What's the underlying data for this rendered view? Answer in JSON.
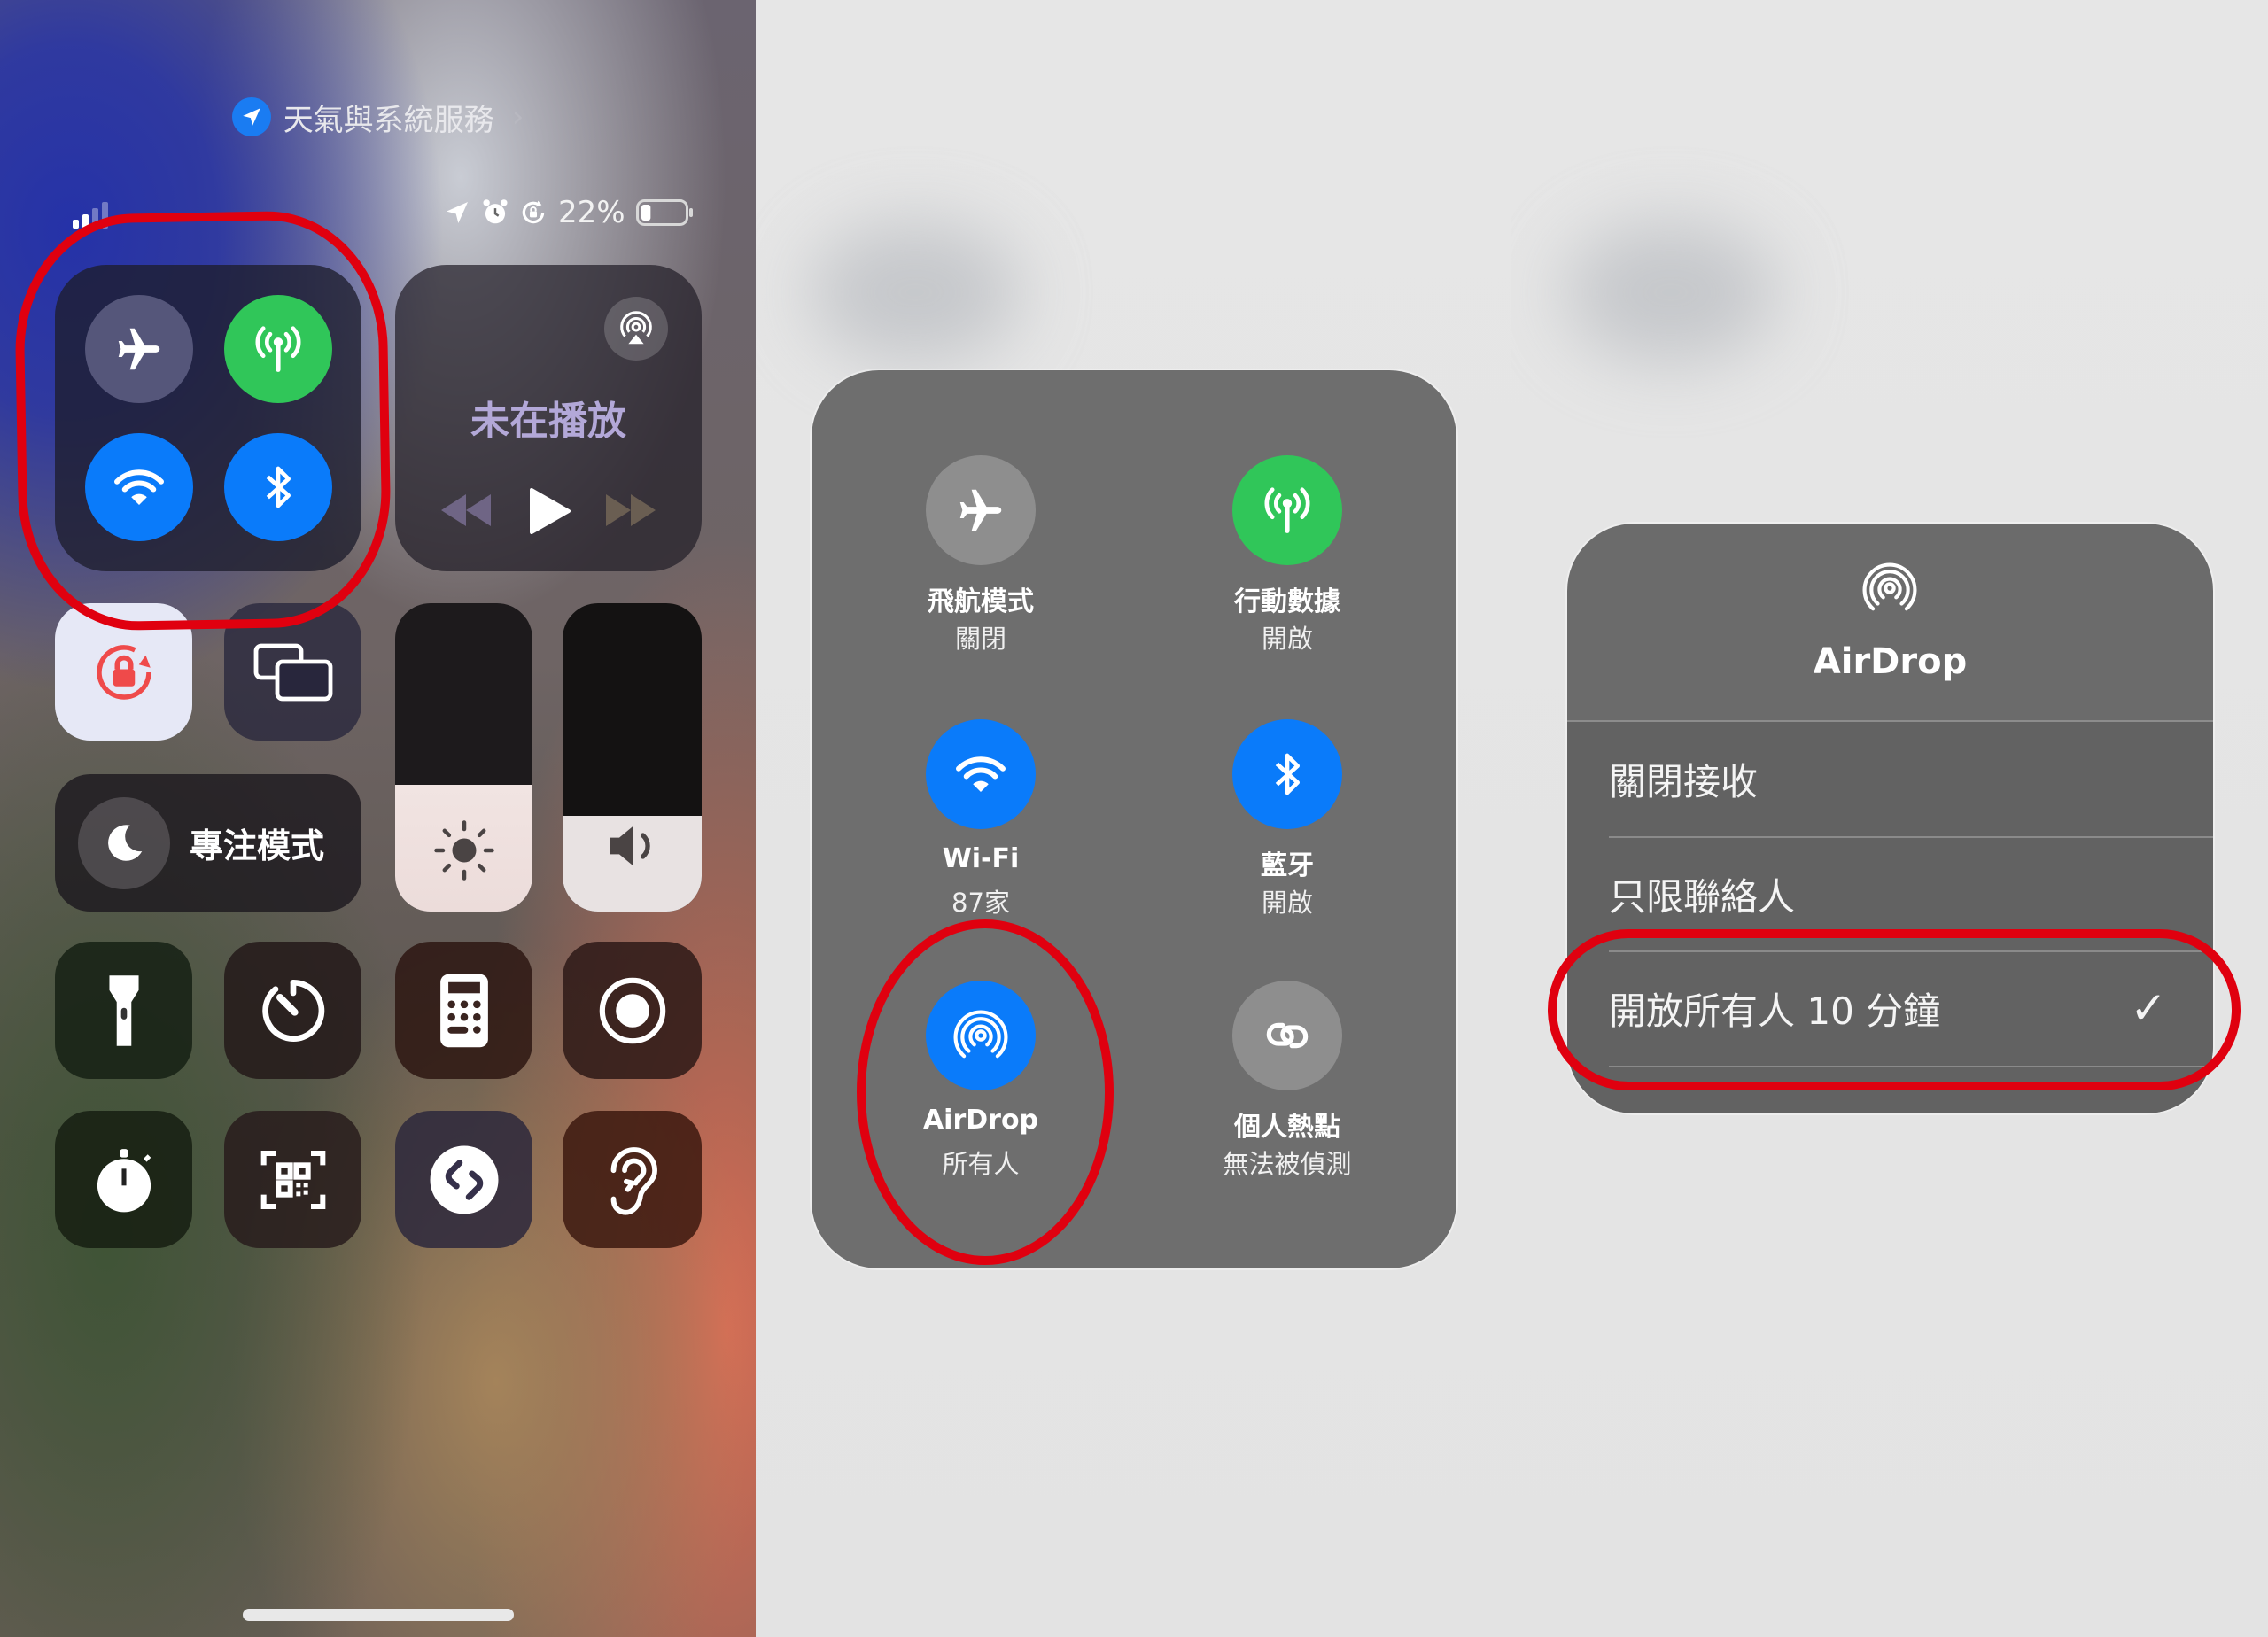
{
  "panel1": {
    "header": {
      "location_icon": "location-arrow-icon",
      "text": "天氣與系統服務",
      "chevron": "›"
    },
    "status_bar": {
      "signal_icon": "cellular-signal-icon",
      "icons": [
        "location-arrow-icon",
        "alarm-icon",
        "orientation-lock-icon"
      ],
      "battery_percent": "22%",
      "battery_level": 0.22
    },
    "connectivity": [
      {
        "id": "airplane",
        "icon": "airplane-icon",
        "state": "off",
        "color": "#55567a"
      },
      {
        "id": "cellular",
        "icon": "antenna-icon",
        "state": "on",
        "color": "#30c659"
      },
      {
        "id": "wifi",
        "icon": "wifi-icon",
        "state": "on",
        "color": "#0a7bfa"
      },
      {
        "id": "bluetooth",
        "icon": "bluetooth-icon",
        "state": "on",
        "color": "#0a7bfa"
      }
    ],
    "media": {
      "airplay_icon": "airplay-icon",
      "title": "未在播放",
      "controls": [
        "rewind-icon",
        "play-icon",
        "fast-forward-icon"
      ]
    },
    "rotation_lock": {
      "icon": "rotation-lock-icon",
      "active": true,
      "color": "#ef4a4a"
    },
    "screen_mirroring": {
      "icon": "screen-mirroring-icon"
    },
    "focus": {
      "icon": "moon-icon",
      "label": "專注模式"
    },
    "brightness": {
      "icon": "sun-icon",
      "level": 0.41
    },
    "volume": {
      "icon": "speaker-icon",
      "level": 0.31
    },
    "shortcuts": [
      {
        "icon": "flashlight-icon"
      },
      {
        "icon": "timer-icon"
      },
      {
        "icon": "calculator-icon"
      },
      {
        "icon": "screen-record-icon"
      },
      {
        "icon": "stopwatch-icon"
      },
      {
        "icon": "qr-scanner-icon"
      },
      {
        "icon": "shazam-icon"
      },
      {
        "icon": "hearing-icon"
      }
    ]
  },
  "panel2": {
    "items": [
      {
        "id": "airplane",
        "icon": "airplane-icon",
        "label": "飛航模式",
        "status": "關閉",
        "color": "#8e8e8e"
      },
      {
        "id": "cellular",
        "icon": "antenna-icon",
        "label": "行動數據",
        "status": "開啟",
        "color": "#30c659"
      },
      {
        "id": "wifi",
        "icon": "wifi-icon",
        "label": "Wi-Fi",
        "status": "87家",
        "color": "#0a7bfa"
      },
      {
        "id": "bluetooth",
        "icon": "bluetooth-icon",
        "label": "藍牙",
        "status": "開啟",
        "color": "#0a7bfa"
      },
      {
        "id": "airdrop",
        "icon": "airdrop-icon",
        "label": "AirDrop",
        "status": "所有人",
        "color": "#0a7bfa"
      },
      {
        "id": "hotspot",
        "icon": "hotspot-icon",
        "label": "個人熱點",
        "status": "無法被偵測",
        "color": "#8e8e8e"
      }
    ]
  },
  "panel3": {
    "menu": {
      "icon": "airdrop-icon",
      "title": "AirDrop",
      "options": [
        {
          "label": "關閉接收",
          "selected": false
        },
        {
          "label": "只限聯絡人",
          "selected": false
        },
        {
          "label": "開放所有人 10 分鐘",
          "selected": true
        }
      ],
      "check": "✓"
    }
  },
  "annotation_color": "#e0000f"
}
